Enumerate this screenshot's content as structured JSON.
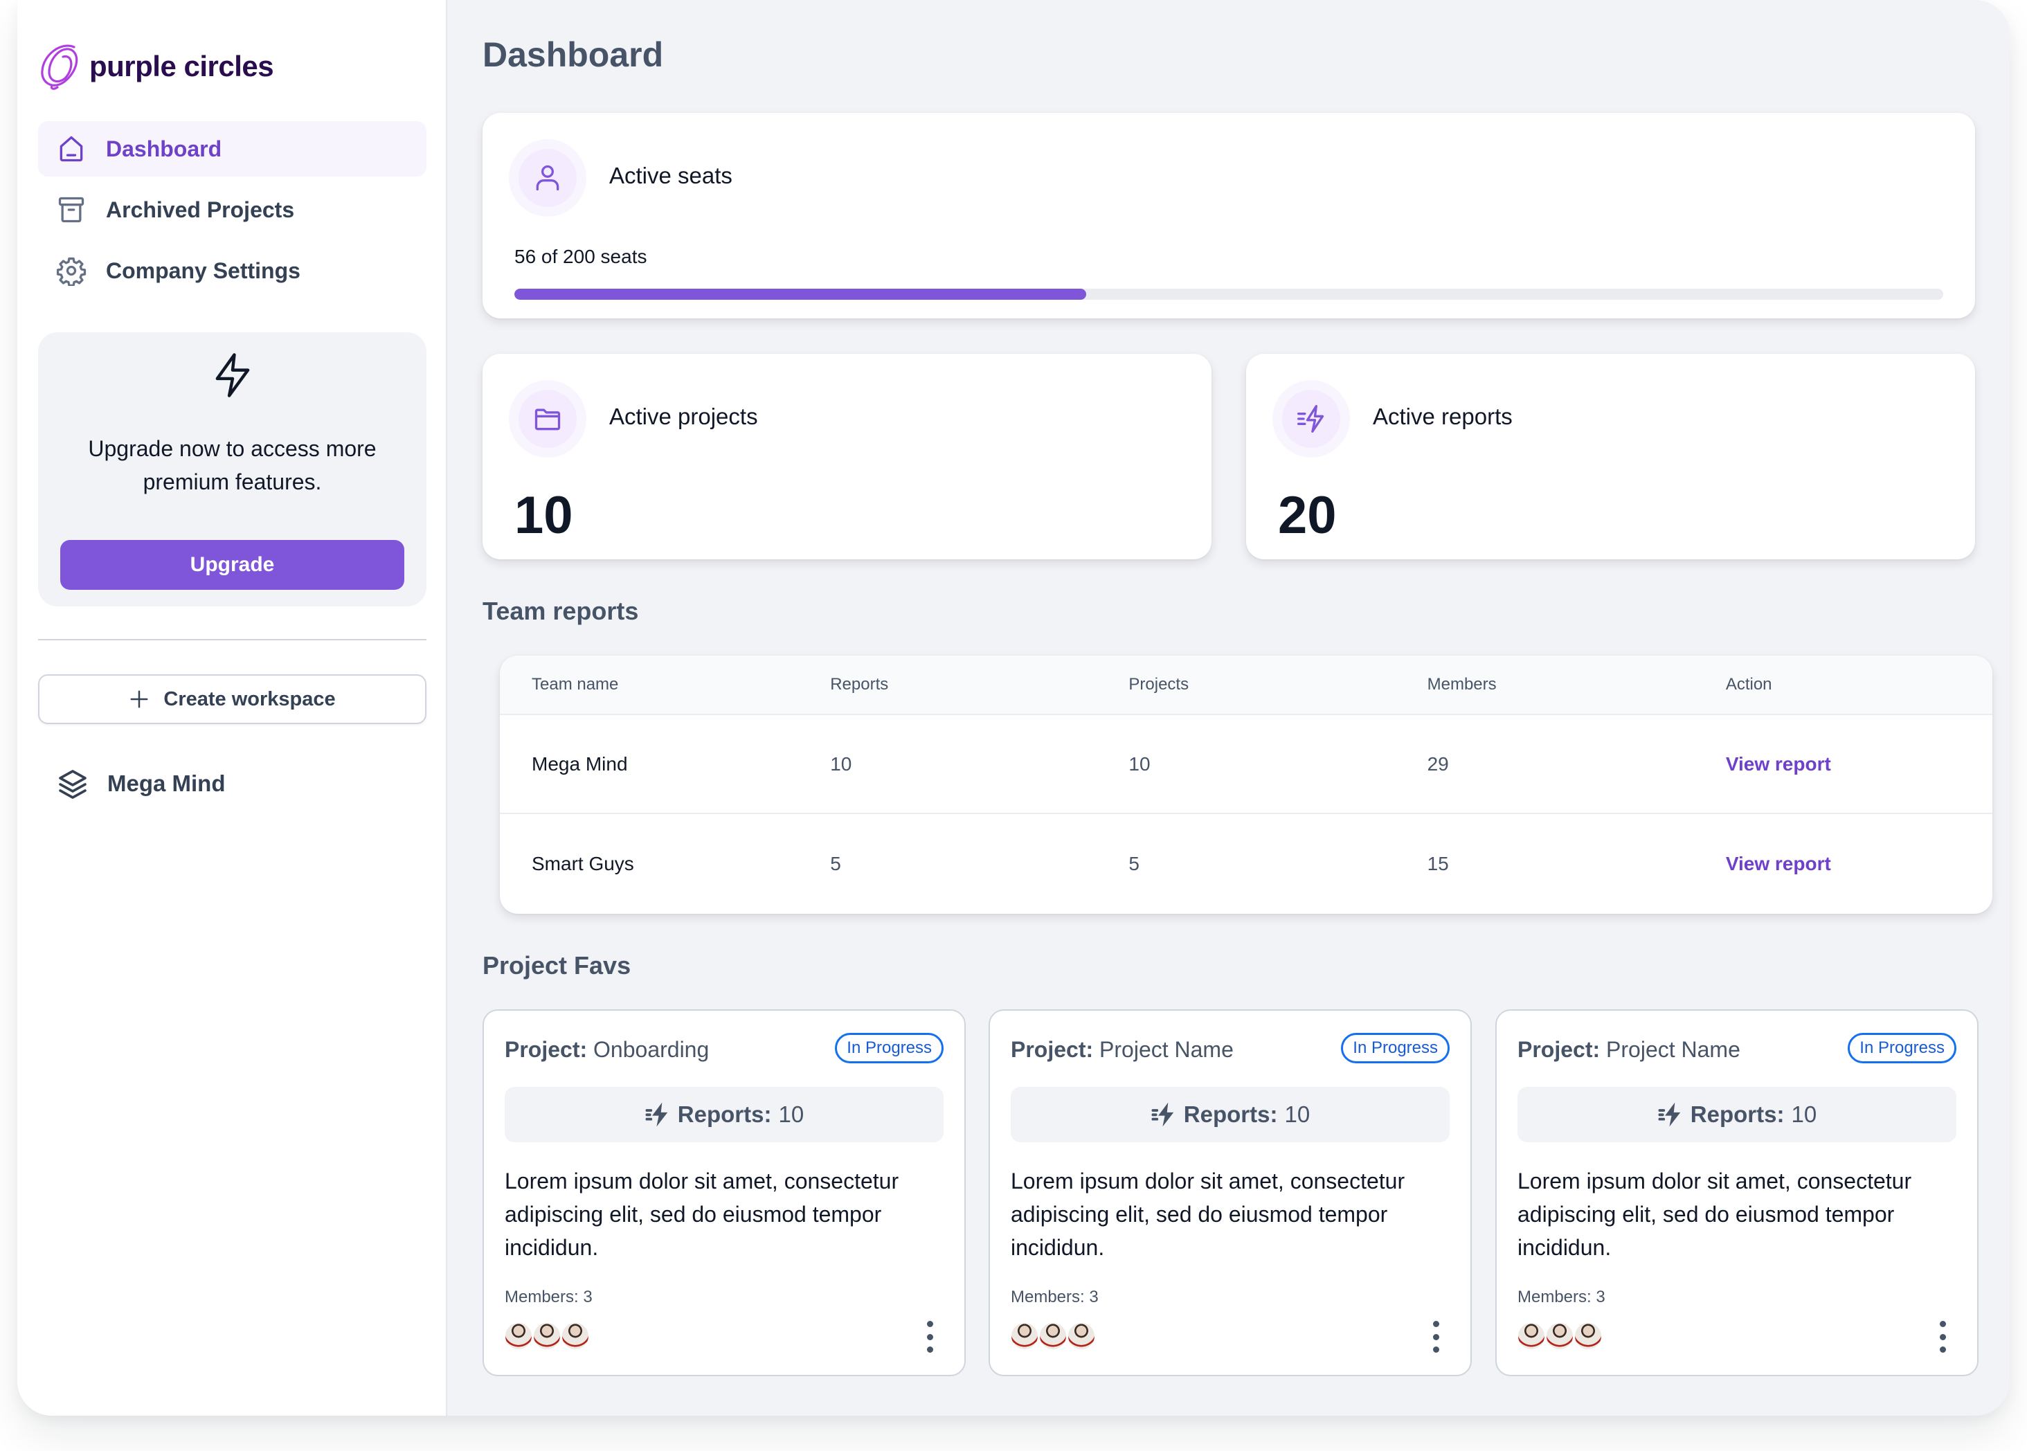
{
  "brand": {
    "name": "purple circles",
    "logo_icon": "scribble-circle-logo",
    "accent": "#7F56D9",
    "logo_color": "#B03FE0",
    "wordmark_color": "#2A0D4F"
  },
  "sidebar": {
    "nav": [
      {
        "label": "Dashboard",
        "icon": "home-icon",
        "active": true
      },
      {
        "label": "Archived Projects",
        "icon": "archive-icon",
        "active": false
      },
      {
        "label": "Company Settings",
        "icon": "gear-icon",
        "active": false
      }
    ],
    "upgrade": {
      "icon": "lightning-icon",
      "text": "Upgrade now to access more premium features.",
      "button_label": "Upgrade"
    },
    "create_workspace_label": "Create workspace",
    "workspaces": [
      {
        "label": "Mega Mind",
        "icon": "layers-icon"
      }
    ]
  },
  "main": {
    "title": "Dashboard",
    "active_seats": {
      "label": "Active seats",
      "icon": "user-icon",
      "used": 56,
      "total": 200,
      "summary": "56 of 200 seats",
      "bar_fill_fraction": 0.4
    },
    "stats": [
      {
        "label": "Active projects",
        "icon": "folder-icon",
        "value": "10"
      },
      {
        "label": "Active reports",
        "icon": "fast-lightning-icon",
        "value": "20"
      }
    ],
    "team_reports": {
      "title": "Team reports",
      "columns": [
        "Team name",
        "Reports",
        "Projects",
        "Members",
        "Action"
      ],
      "rows": [
        {
          "team": "Mega Mind",
          "reports": "10",
          "projects": "10",
          "members": "29",
          "action": "View report"
        },
        {
          "team": "Smart Guys",
          "reports": "5",
          "projects": "5",
          "members": "15",
          "action": "View report"
        }
      ]
    },
    "project_favs": {
      "title": "Project Favs",
      "cards": [
        {
          "project_label": "Project:",
          "project_name": "Onboarding",
          "status": "In Progress",
          "reports_label": "Reports:",
          "reports_value": "10",
          "description": "Lorem ipsum dolor sit amet, consectetur adipiscing elit, sed do eiusmod tempor incididun.",
          "members_text": "Members: 3",
          "member_count": 3
        },
        {
          "project_label": "Project:",
          "project_name": "Project Name",
          "status": "In Progress",
          "reports_label": "Reports:",
          "reports_value": "10",
          "description": "Lorem ipsum dolor sit amet, consectetur adipiscing elit, sed do eiusmod tempor incididun.",
          "members_text": "Members: 3",
          "member_count": 3
        },
        {
          "project_label": "Project:",
          "project_name": "Project Name",
          "status": "In Progress",
          "reports_label": "Reports:",
          "reports_value": "10",
          "description": "Lorem ipsum dolor sit amet, consectetur adipiscing elit, sed do eiusmod tempor incididun.",
          "members_text": "Members: 3",
          "member_count": 3
        }
      ]
    }
  }
}
